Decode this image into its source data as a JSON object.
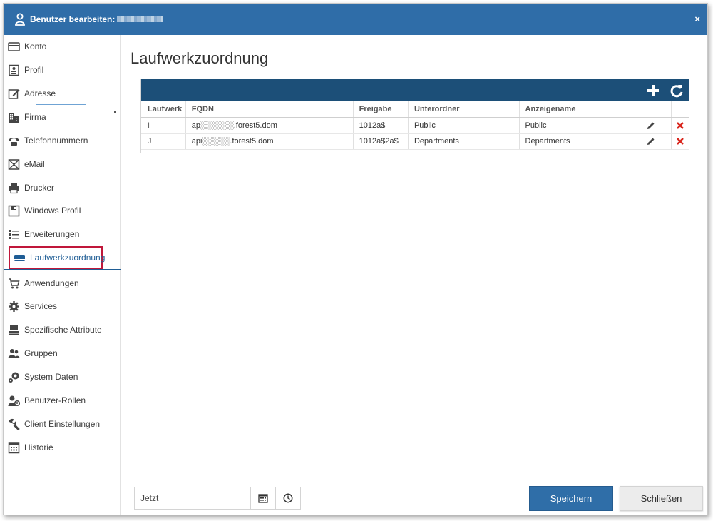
{
  "window": {
    "title": "Benutzer bearbeiten:",
    "close_glyph": "×"
  },
  "sidebar": {
    "items": [
      {
        "label": "Konto",
        "icon": "credit-card-icon"
      },
      {
        "label": "Profil",
        "icon": "profile-card-icon"
      },
      {
        "label": "Adresse",
        "icon": "edit-address-icon"
      },
      {
        "label": "Firma",
        "icon": "building-icon"
      },
      {
        "label": "Telefonnummern",
        "icon": "phone-icon"
      },
      {
        "label": "eMail",
        "icon": "envelope-icon"
      },
      {
        "label": "Drucker",
        "icon": "printer-icon"
      },
      {
        "label": "Windows Profil",
        "icon": "floppy-disk-icon"
      },
      {
        "label": "Erweiterungen",
        "icon": "list-icon"
      },
      {
        "label": "Laufwerkzuordnung",
        "icon": "drive-icon",
        "active": true
      },
      {
        "label": "Anwendungen",
        "icon": "cart-icon"
      },
      {
        "label": "Services",
        "icon": "gear-icon"
      },
      {
        "label": "Spezifische Attribute",
        "icon": "stack-icon"
      },
      {
        "label": "Gruppen",
        "icon": "group-icon"
      },
      {
        "label": "System Daten",
        "icon": "cogs-icon"
      },
      {
        "label": "Benutzer-Rollen",
        "icon": "user-role-icon"
      },
      {
        "label": "Client Einstellungen",
        "icon": "wrench-icon"
      },
      {
        "label": "Historie",
        "icon": "calendar-grid-icon"
      }
    ]
  },
  "main": {
    "title": "Laufwerkzuordnung",
    "grid": {
      "columns": [
        "Laufwerk",
        "FQDN",
        "Freigabe",
        "Unterordner",
        "Anzeigename"
      ],
      "rows": [
        {
          "laufwerk": "I",
          "fqdn": "ap░░░░░░.forest5.dom",
          "freigabe": "1012a$",
          "unterordner": "Public",
          "anzeigename": "Public"
        },
        {
          "laufwerk": "J",
          "fqdn": "api░░░░░.forest5.dom",
          "freigabe": "1012a$2a$",
          "unterordner": "Departments",
          "anzeigename": "Departments"
        }
      ]
    }
  },
  "footer": {
    "date_value": "Jetzt",
    "save_label": "Speichern",
    "close_label": "Schließen"
  },
  "colors": {
    "titlebar": "#2f6da8",
    "grid_toolbar": "#1c4f78",
    "active_border": "#c0173a",
    "delete_red": "#d9251c"
  }
}
